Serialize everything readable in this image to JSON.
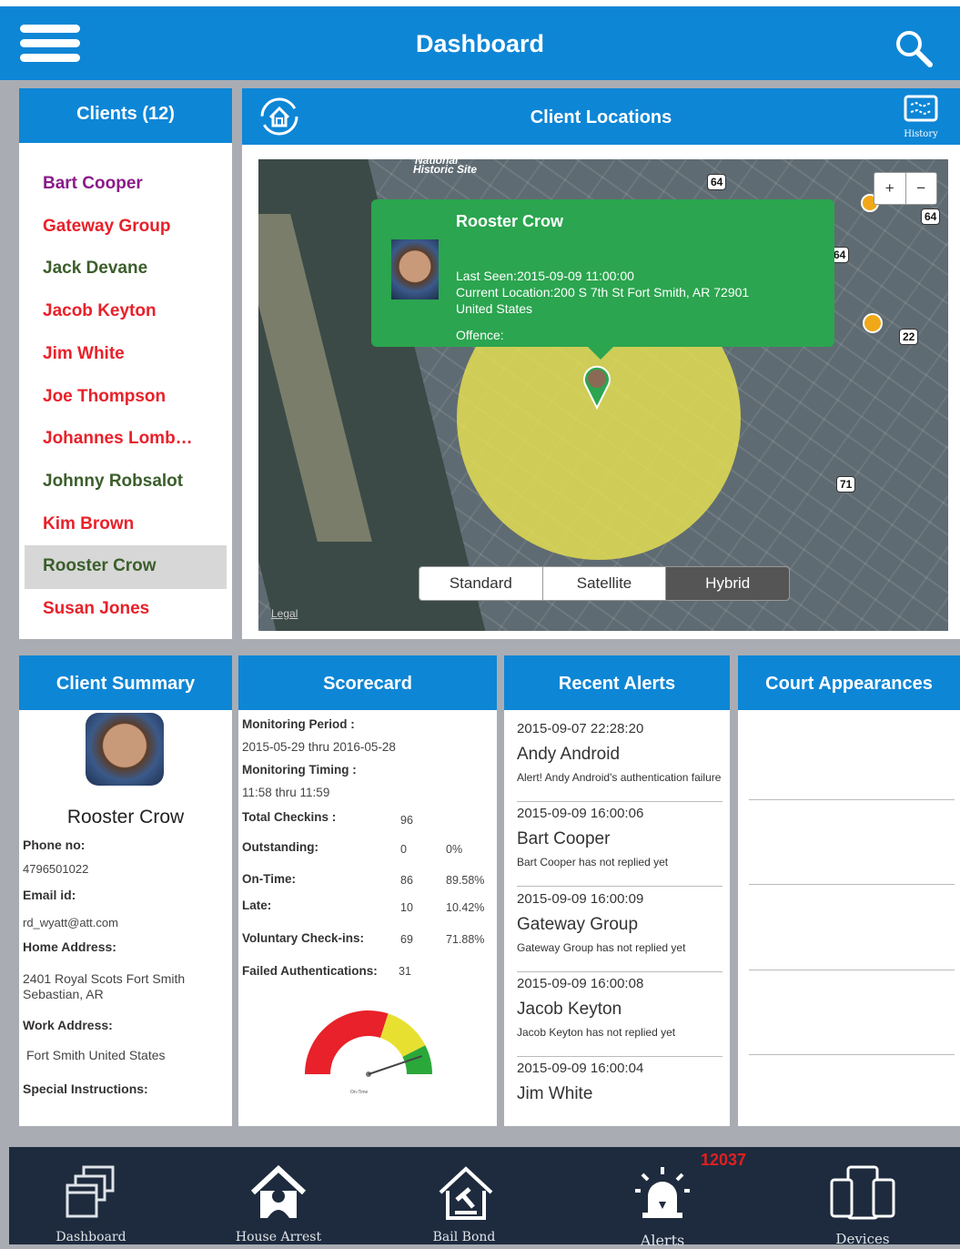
{
  "header": {
    "title": "Dashboard"
  },
  "clients": {
    "title": "Clients (12)",
    "items": [
      {
        "name": "Bart Cooper",
        "color": "#8a1a8a"
      },
      {
        "name": "Gateway Group",
        "color": "#e8212a"
      },
      {
        "name": "Jack Devane",
        "color": "#3b5e2b"
      },
      {
        "name": "Jacob Keyton",
        "color": "#e8212a"
      },
      {
        "name": "Jim White",
        "color": "#e8212a"
      },
      {
        "name": "Joe Thompson",
        "color": "#e8212a"
      },
      {
        "name": "Johannes Lomb…",
        "color": "#e8212a"
      },
      {
        "name": "Johnny Robsalot",
        "color": "#3b5e2b"
      },
      {
        "name": "Kim  Brown",
        "color": "#e8212a"
      },
      {
        "name": "Rooster Crow",
        "color": "#3b5e2b"
      },
      {
        "name": "Susan Jones",
        "color": "#e8212a"
      }
    ],
    "selected": "Rooster Crow"
  },
  "locations": {
    "title": "Client Locations",
    "history_label": "History",
    "map": {
      "popup": {
        "name": "Rooster Crow",
        "last_seen": "Last Seen:2015-09-09 11:00:00",
        "location": "Current Location:200 S 7th St Fort Smith, AR  72901",
        "country": "United States",
        "offence": "Offence:"
      },
      "map_types": [
        "Standard",
        "Satellite",
        "Hybrid"
      ],
      "selected_type": "Hybrid",
      "zoom_in": "+",
      "zoom_out": "−",
      "legal": "Legal",
      "labels": {
        "historic": "Historic Site",
        "national": "National",
        "hw64a": "64",
        "hw64b": "64",
        "hw64c": "64",
        "hw22": "22",
        "hw71": "71"
      }
    }
  },
  "summary": {
    "title": "Client Summary",
    "name": "Rooster Crow",
    "phone_label": "Phone no:",
    "phone": "4796501022",
    "email_label": "Email id:",
    "email": "rd_wyatt@att.com",
    "home_label": "Home Address:",
    "home": "2401 Royal Scots Fort Smith Sebastian, AR",
    "work_label": "Work Address:",
    "work": "Fort Smith United States",
    "special_label": "Special Instructions:"
  },
  "scorecard": {
    "title": "Scorecard",
    "period_label": "Monitoring Period :",
    "period": "2015-05-29 thru 2016-05-28",
    "timing_label": "Monitoring Timing :",
    "timing": "11:58 thru 11:59",
    "rows": [
      {
        "label": "Total Checkins :",
        "count": "96",
        "pct": ""
      },
      {
        "label": "Outstanding:",
        "count": "0",
        "pct": "0%"
      },
      {
        "label": "On-Time:",
        "count": "86",
        "pct": "89.58%"
      },
      {
        "label": "Late:",
        "count": "10",
        "pct": "10.42%"
      },
      {
        "label": "Voluntary Check-ins:",
        "count": "69",
        "pct": "71.88%"
      }
    ],
    "failed_label": "Failed Authentications:",
    "failed": "31",
    "gauge_label": "On-Time",
    "gauge_value": 0.8958,
    "gauge_colors": {
      "red": "#e8212a",
      "yellow": "#e8e030",
      "green": "#2ba83a"
    }
  },
  "alerts": {
    "title": "Recent Alerts",
    "items": [
      {
        "date": "2015-09-07 22:28:20",
        "name": "Andy Android",
        "msg": "Alert! Andy Android's authentication failure"
      },
      {
        "date": "2015-09-09 16:00:06",
        "name": "Bart Cooper",
        "msg": "Bart Cooper has not replied yet"
      },
      {
        "date": "2015-09-09 16:00:09",
        "name": "Gateway Group",
        "msg": "Gateway Group has not replied yet"
      },
      {
        "date": "2015-09-09 16:00:08",
        "name": "Jacob Keyton",
        "msg": "Jacob Keyton has not replied yet"
      },
      {
        "date": "2015-09-09 16:00:04",
        "name": "Jim White",
        "msg": ""
      }
    ]
  },
  "court": {
    "title": "Court Appearances"
  },
  "tabbar": {
    "tabs": [
      "Dashboard",
      "House Arrest",
      "Bail Bond",
      "Alerts",
      "Devices"
    ],
    "alerts_badge": "12037"
  },
  "colors": {
    "accent": "#0e86d6",
    "tabbar": "#1e2b3e",
    "popup": "#2ba54f"
  }
}
